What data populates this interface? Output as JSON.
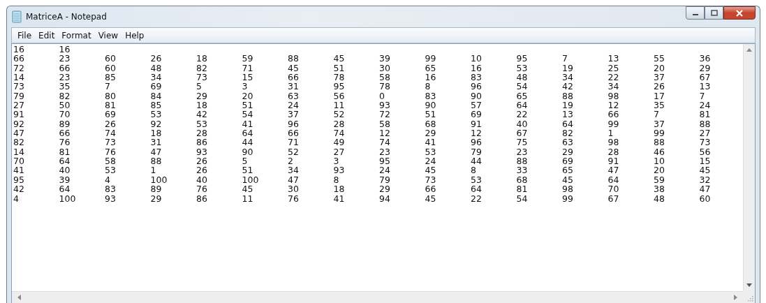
{
  "window": {
    "title": "MatriceA - Notepad"
  },
  "menu": [
    "File",
    "Edit",
    "Format",
    "View",
    "Help"
  ],
  "lines": [
    "16\t16",
    "66\t23\t60\t26\t18\t59\t88\t45\t39\t99\t10\t95\t7\t13\t55\t36",
    "72\t66\t60\t48\t82\t71\t45\t51\t30\t65\t16\t53\t19\t25\t20\t29",
    "14\t23\t85\t34\t73\t15\t66\t78\t58\t16\t83\t48\t34\t22\t37\t67",
    "73\t35\t7\t69\t5\t3\t31\t95\t78\t8\t96\t54\t42\t34\t26\t13",
    "79\t82\t80\t84\t29\t20\t63\t56\t0\t83\t90\t65\t88\t98\t17\t7",
    "27\t50\t81\t85\t18\t51\t24\t11\t93\t90\t57\t64\t19\t12\t35\t24",
    "91\t70\t69\t53\t42\t54\t37\t52\t72\t51\t69\t22\t13\t66\t7\t81",
    "92\t89\t26\t92\t53\t41\t96\t28\t58\t68\t91\t40\t64\t99\t37\t88",
    "47\t66\t74\t18\t28\t64\t66\t74\t12\t29\t12\t67\t82\t1\t99\t27",
    "82\t76\t73\t31\t86\t44\t71\t49\t74\t41\t96\t75\t63\t98\t88\t73",
    "14\t81\t76\t47\t93\t90\t52\t27\t23\t53\t79\t23\t29\t28\t46\t56",
    "70\t64\t58\t88\t26\t5\t2\t3\t95\t24\t44\t88\t69\t91\t10\t15",
    "41\t40\t53\t1\t26\t51\t34\t93\t24\t45\t8\t33\t65\t47\t20\t45",
    "95\t39\t4\t100\t40\t100\t47\t8\t79\t73\t53\t68\t45\t64\t59\t32",
    "42\t64\t83\t89\t76\t45\t30\t18\t29\t66\t64\t81\t98\t70\t38\t47",
    "4\t100\t93\t29\t86\t11\t76\t41\t94\t45\t22\t54\t99\t67\t48\t60"
  ]
}
